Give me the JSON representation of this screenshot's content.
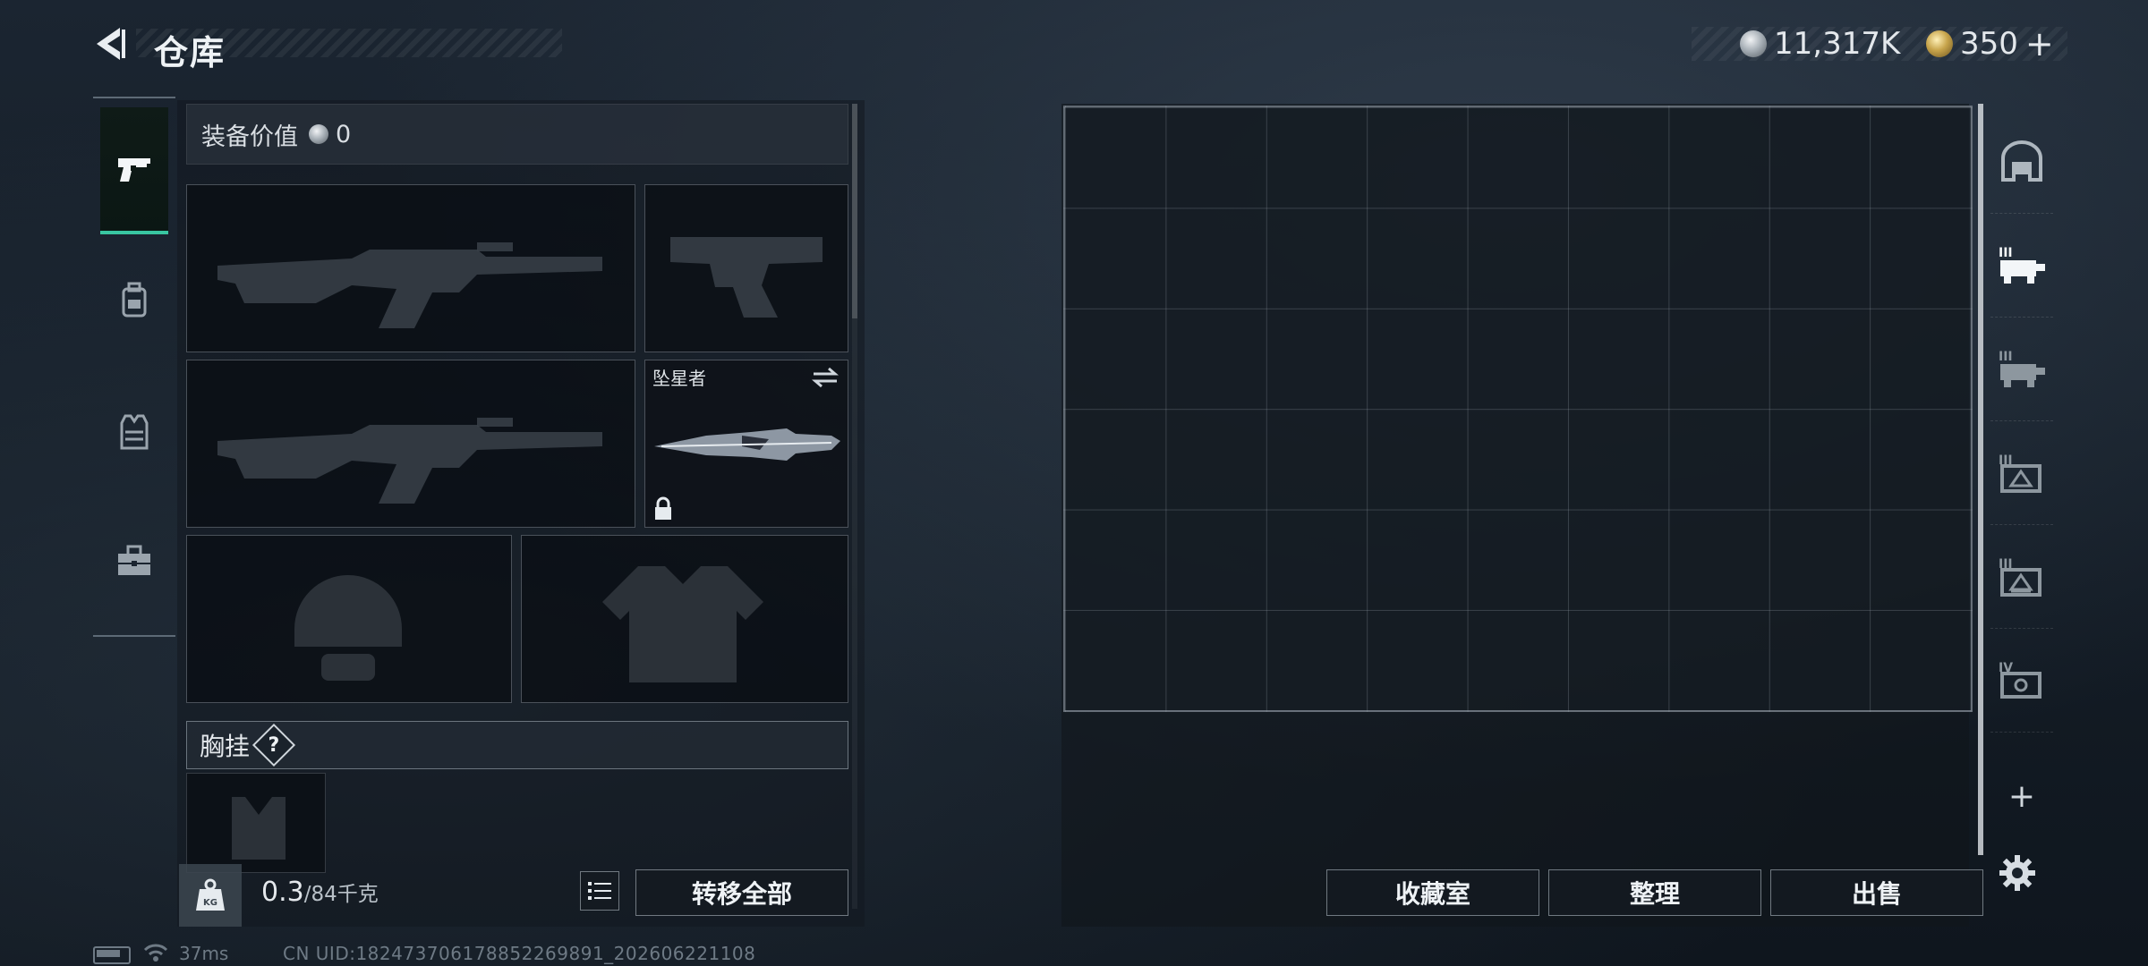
{
  "header": {
    "title": "仓库",
    "currencies": [
      {
        "name": "silver-coin",
        "value": "11,317K"
      },
      {
        "name": "gold-coin",
        "value": "350"
      }
    ],
    "gold_add_symbol": "+"
  },
  "category_nav": {
    "items": [
      {
        "icon": "pistol-icon",
        "active": true
      },
      {
        "icon": "backpack-icon",
        "active": false
      },
      {
        "icon": "vest-icon",
        "active": false
      },
      {
        "icon": "toolbox-icon",
        "active": false
      }
    ]
  },
  "equipment": {
    "value_label": "装备价值",
    "value": "0",
    "slots": [
      {
        "id": "primary-weapon-1",
        "item": "rifle-silhouette"
      },
      {
        "id": "sidearm",
        "item": "pistol-silhouette"
      },
      {
        "id": "primary-weapon-2",
        "item": "rifle-silhouette"
      },
      {
        "id": "melee",
        "item_name": "坠星者",
        "locked": true
      },
      {
        "id": "helmet",
        "item": "helmet-silhouette"
      },
      {
        "id": "body-armor",
        "item": "armor-silhouette"
      }
    ],
    "chest_rig_label": "胸挂",
    "chest_rig_help": "?",
    "weight_current": "0.3",
    "weight_max": "/84千克",
    "transfer_all_label": "转移全部"
  },
  "storage": {
    "grid": {
      "columns": 9,
      "rows": 6
    },
    "buttons": [
      "收藏室",
      "整理",
      "出售"
    ],
    "tabs": [
      {
        "icon": "storage-room-icon"
      },
      {
        "icon": "storage-tier3-a-icon",
        "active": true
      },
      {
        "icon": "storage-tier3-b-icon"
      },
      {
        "icon": "storage-tier3-c-icon"
      },
      {
        "icon": "storage-tier3-d-icon"
      },
      {
        "icon": "storage-tier4-icon"
      }
    ],
    "add_tab_symbol": "+"
  },
  "status": {
    "ping": "37ms",
    "uid": "CN UID:182473706178852269891_202606221108"
  },
  "colors": {
    "accent": "#39c6a1",
    "background": "#151e28"
  }
}
